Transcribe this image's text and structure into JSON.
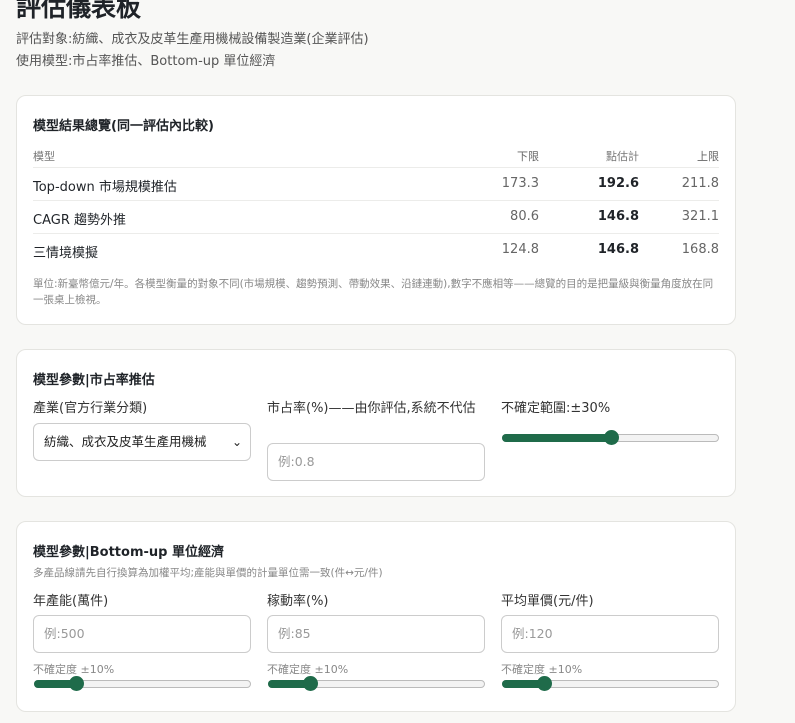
{
  "header": {
    "title": "評估儀表板",
    "target": "評估對象:紡織、成衣及皮革生產用機械設備製造業(企業評估)",
    "models": "使用模型:市占率推估、Bottom-up 單位經濟"
  },
  "results": {
    "title": "模型結果總覽(同一評估內比較)",
    "headers": {
      "model": "模型",
      "low": "下限",
      "point": "點估計",
      "high": "上限"
    },
    "rows": [
      {
        "model": "Top-down 市場規模推估",
        "low": "173.3",
        "point": "192.6",
        "high": "211.8"
      },
      {
        "model": "CAGR 趨勢外推",
        "low": "80.6",
        "point": "146.8",
        "high": "321.1"
      },
      {
        "model": "三情境模擬",
        "low": "124.8",
        "point": "146.8",
        "high": "168.8"
      }
    ],
    "note": "單位:新臺幣億元/年。各模型衡量的對象不同(市場規模、趨勢預測、帶動效果、沿鏈連動),數字不應相等——總覽的目的是把量級與衡量角度放在同一張桌上檢視。"
  },
  "market_share": {
    "title": "模型參數|市占率推估",
    "industry_label": "產業(官方行業分類)",
    "industry_value": "紡織、成衣及皮革生產用機械",
    "share_label": "市占率(%)——由你評估,系統不代估",
    "share_placeholder": "例:0.8",
    "range_label": "不確定範圍:±30%",
    "range_value_pct": 30,
    "range_max_pct": 60
  },
  "unit_economics": {
    "title": "模型參數|Bottom-up 單位經濟",
    "subtitle": "多產品線請先自行換算為加權平均;產能與單價的計量單位需一致(件↔元/件)",
    "fields": [
      {
        "label": "年產能(萬件)",
        "placeholder": "例:500",
        "uncertainty": "不確定度 ±10%",
        "value_pct": 10,
        "max_pct": 60
      },
      {
        "label": "稼動率(%)",
        "placeholder": "例:85",
        "uncertainty": "不確定度 ±10%",
        "value_pct": 10,
        "max_pct": 60
      },
      {
        "label": "平均單價(元/件)",
        "placeholder": "例:120",
        "uncertainty": "不確定度 ±10%",
        "value_pct": 10,
        "max_pct": 60
      }
    ]
  },
  "colors": {
    "accent": "#1f6b4a"
  }
}
